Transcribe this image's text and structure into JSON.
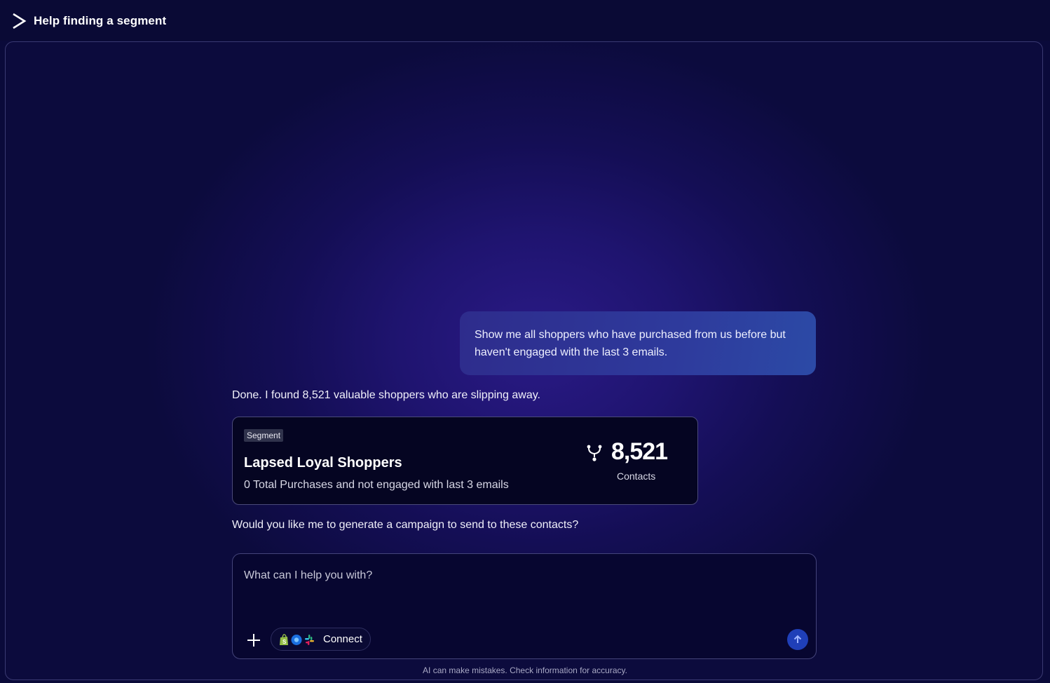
{
  "header": {
    "title": "Help finding a segment"
  },
  "conversation": {
    "user_message": "Show me all shoppers who have purchased from us before but haven't engaged with the last 3 emails.",
    "ai_intro": "Done. I found 8,521 valuable shoppers who are slipping away.",
    "ai_followup": "Would you like me to generate a campaign to send to these contacts?"
  },
  "segment_card": {
    "badge": "Segment",
    "name": "Lapsed Loyal Shoppers",
    "description": "0 Total Purchases and not engaged with last 3 emails",
    "count": "8,521",
    "count_label": "Contacts",
    "icon": "merge-icon"
  },
  "composer": {
    "placeholder": "What can I help you with?",
    "value": "",
    "connect_label": "Connect",
    "connect_icons": [
      "shopify-icon",
      "integration-icon",
      "slack-icon"
    ]
  },
  "footer": {
    "disclaimer": "AI can make mistakes. Check information for accuracy."
  },
  "colors": {
    "background": "#0a0a3a",
    "bubble": "#2e3a9c",
    "send_button": "#1f3fb8"
  }
}
